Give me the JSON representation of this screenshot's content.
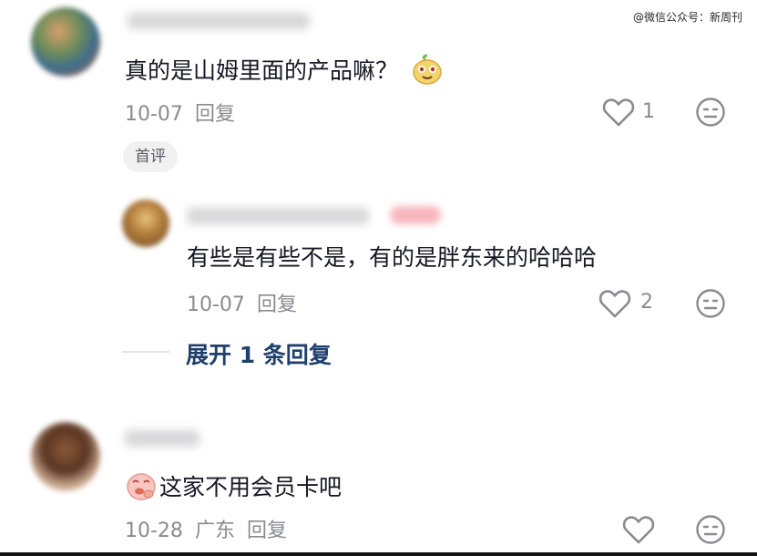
{
  "watermark": "@微信公众号：新周刊",
  "comments": [
    {
      "text": "真的是山姆里面的产品嘛？",
      "date": "10-07",
      "reply_label": "回复",
      "like_count": "1",
      "badge": "首评",
      "emoji": "smiling-yellow-face-emoji"
    },
    {
      "text": "有些是有些不是，有的是胖东来的哈哈哈",
      "date": "10-07",
      "reply_label": "回复",
      "like_count": "2"
    },
    {
      "text": "这家不用会员卡吧",
      "date": "10-28",
      "location": "广东",
      "reply_label": "回复",
      "like_count": "",
      "emoji": "pink-thinking-face-emoji"
    }
  ],
  "expand_replies": "展开 1 条回复",
  "icons": {
    "like": "heart-outline-icon",
    "dislike": "meh-face-outline-icon"
  },
  "colors": {
    "text": "#161823",
    "meta": "#8a8b91",
    "link": "#1f3f6d"
  }
}
